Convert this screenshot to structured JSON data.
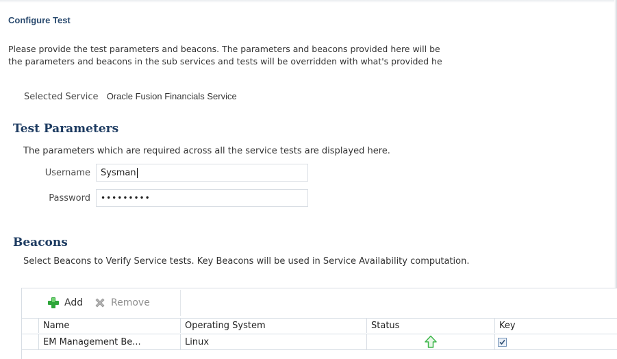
{
  "page": {
    "title": "Configure Test",
    "intro_line1": "Please provide the test parameters and beacons. The parameters and beacons provided here will be",
    "intro_line2": "the parameters and beacons in the sub services and tests will be overridden with what's provided he",
    "selected_service_label": "Selected Service",
    "selected_service_value": "Oracle Fusion Financials Service"
  },
  "test_parameters": {
    "heading": "Test Parameters",
    "description": "The parameters which are required across all the service tests are displayed here.",
    "username_label": "Username",
    "username_value": "Sysman",
    "password_label": "Password",
    "password_mask": "•••••••••"
  },
  "beacons": {
    "heading": "Beacons",
    "description": "Select Beacons to Verify Service tests. Key Beacons will be used in Service Availability computation.",
    "toolbar": {
      "add_label": "Add",
      "remove_label": "Remove"
    },
    "columns": [
      "Name",
      "Operating System",
      "Status",
      "Key"
    ],
    "rows": [
      {
        "name": "EM Management Be...",
        "os": "Linux",
        "status": "up",
        "key": true
      }
    ]
  },
  "icons": {
    "add": "plus-icon",
    "remove": "remove-x-icon",
    "status": "up-arrow-icon",
    "key": "checkbox-checked-icon"
  },
  "colors": {
    "heading": "#1d3b61",
    "title": "#2b4b6f",
    "status_up": "#3cb64a",
    "add_icon": "#2ea63a"
  }
}
